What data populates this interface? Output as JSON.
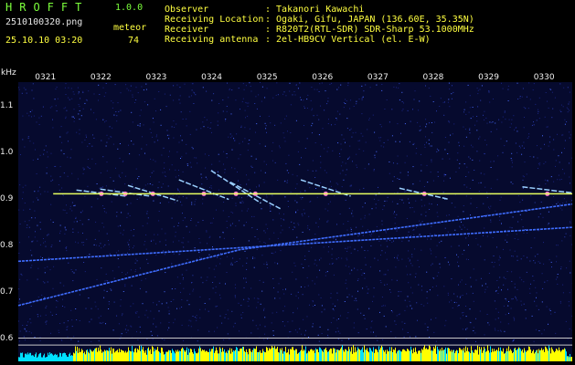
{
  "header": {
    "app_title": "HROFFT",
    "version": "1.0.0",
    "filename": "2510100320.png",
    "label_meteor": "meteor",
    "datetime": "25.10.10 03:20",
    "meteor_count": "74"
  },
  "info": [
    {
      "key": "Observer",
      "value": ": Takanori Kawachi"
    },
    {
      "key": "Receiving Location",
      "value": ": Ogaki, Gifu, JAPAN (136.60E, 35.35N)"
    },
    {
      "key": "Receiver",
      "value": ": R820T2(RTL-SDR) SDR-Sharp 53.1000MHz"
    },
    {
      "key": "Receiving antenna",
      "value": ": 2el-HB9CV Vertical (el. E-W)"
    }
  ],
  "colors": {
    "background": "#000000",
    "plot_background": "#060a2e",
    "header_green": "#7cff3c",
    "header_yellow": "#ffff40",
    "carrier_line": "#e8ff60",
    "meteor_trace": "#9ad0ff",
    "level_bar_yellow": "#ffff00",
    "level_bar_cyan": "#00e0ff"
  },
  "chart_data": {
    "type": "heatmap",
    "ylabel": "kHz",
    "x_ticks": [
      "0321",
      "0322",
      "0323",
      "0324",
      "0325",
      "0326",
      "0327",
      "0328",
      "0329",
      "0330"
    ],
    "y_ticks": [
      "1.1",
      "1.0",
      "0.9",
      "0.8",
      "0.7",
      "0.6"
    ],
    "xlim": [
      0,
      10
    ],
    "ylim": [
      0.55,
      1.15
    ],
    "carrier": {
      "freq_khz": 0.91,
      "x_start": 0.63,
      "x_end": 10
    },
    "drifting_traces": [
      {
        "points": [
          [
            0.0,
            0.765
          ],
          [
            10.0,
            0.838
          ]
        ]
      },
      {
        "points": [
          [
            0.0,
            0.67
          ],
          [
            4.0,
            0.79
          ],
          [
            10.0,
            0.888
          ]
        ]
      }
    ],
    "meteor_echoes": [
      {
        "x": 1.5,
        "freq_start": 0.918,
        "freq_end": 0.905
      },
      {
        "x": 1.93,
        "freq_start": 0.92,
        "freq_end": 0.905
      },
      {
        "x": 2.43,
        "freq_start": 0.928,
        "freq_end": 0.895
      },
      {
        "x": 3.35,
        "freq_start": 0.94,
        "freq_end": 0.898
      },
      {
        "x": 3.93,
        "freq_start": 0.96,
        "freq_end": 0.89
      },
      {
        "x": 4.28,
        "freq_start": 0.935,
        "freq_end": 0.878
      },
      {
        "x": 5.55,
        "freq_start": 0.94,
        "freq_end": 0.905
      },
      {
        "x": 7.33,
        "freq_start": 0.922,
        "freq_end": 0.898
      },
      {
        "x": 9.55,
        "freq_start": 0.925,
        "freq_end": 0.912
      }
    ],
    "reference_lines_khz": [
      0.6,
      0.585
    ],
    "grid": false
  }
}
